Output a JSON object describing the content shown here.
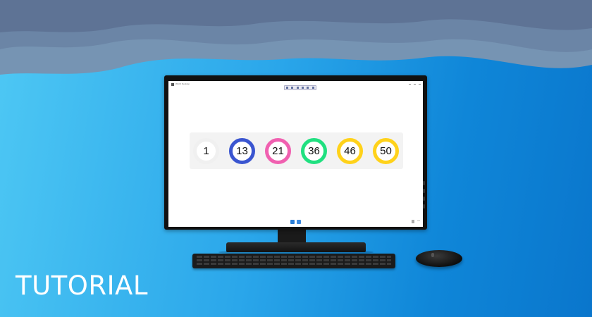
{
  "banner": {
    "label": "TUTORIAL"
  },
  "app_window": {
    "title": "WinUI Desktop",
    "balls": [
      {
        "number": "1",
        "color": "#f0f0f0"
      },
      {
        "number": "13",
        "color": "#3a55d0"
      },
      {
        "number": "21",
        "color": "#f060b0"
      },
      {
        "number": "36",
        "color": "#20e080"
      },
      {
        "number": "46",
        "color": "#ffd21a"
      },
      {
        "number": "50",
        "color": "#ffd21a"
      }
    ]
  },
  "colors": {
    "background_accent": "#2aa6ea",
    "wave_dark": "#5e7395"
  },
  "icons": [
    "windows-start-icon",
    "taskbar-app-icon"
  ]
}
